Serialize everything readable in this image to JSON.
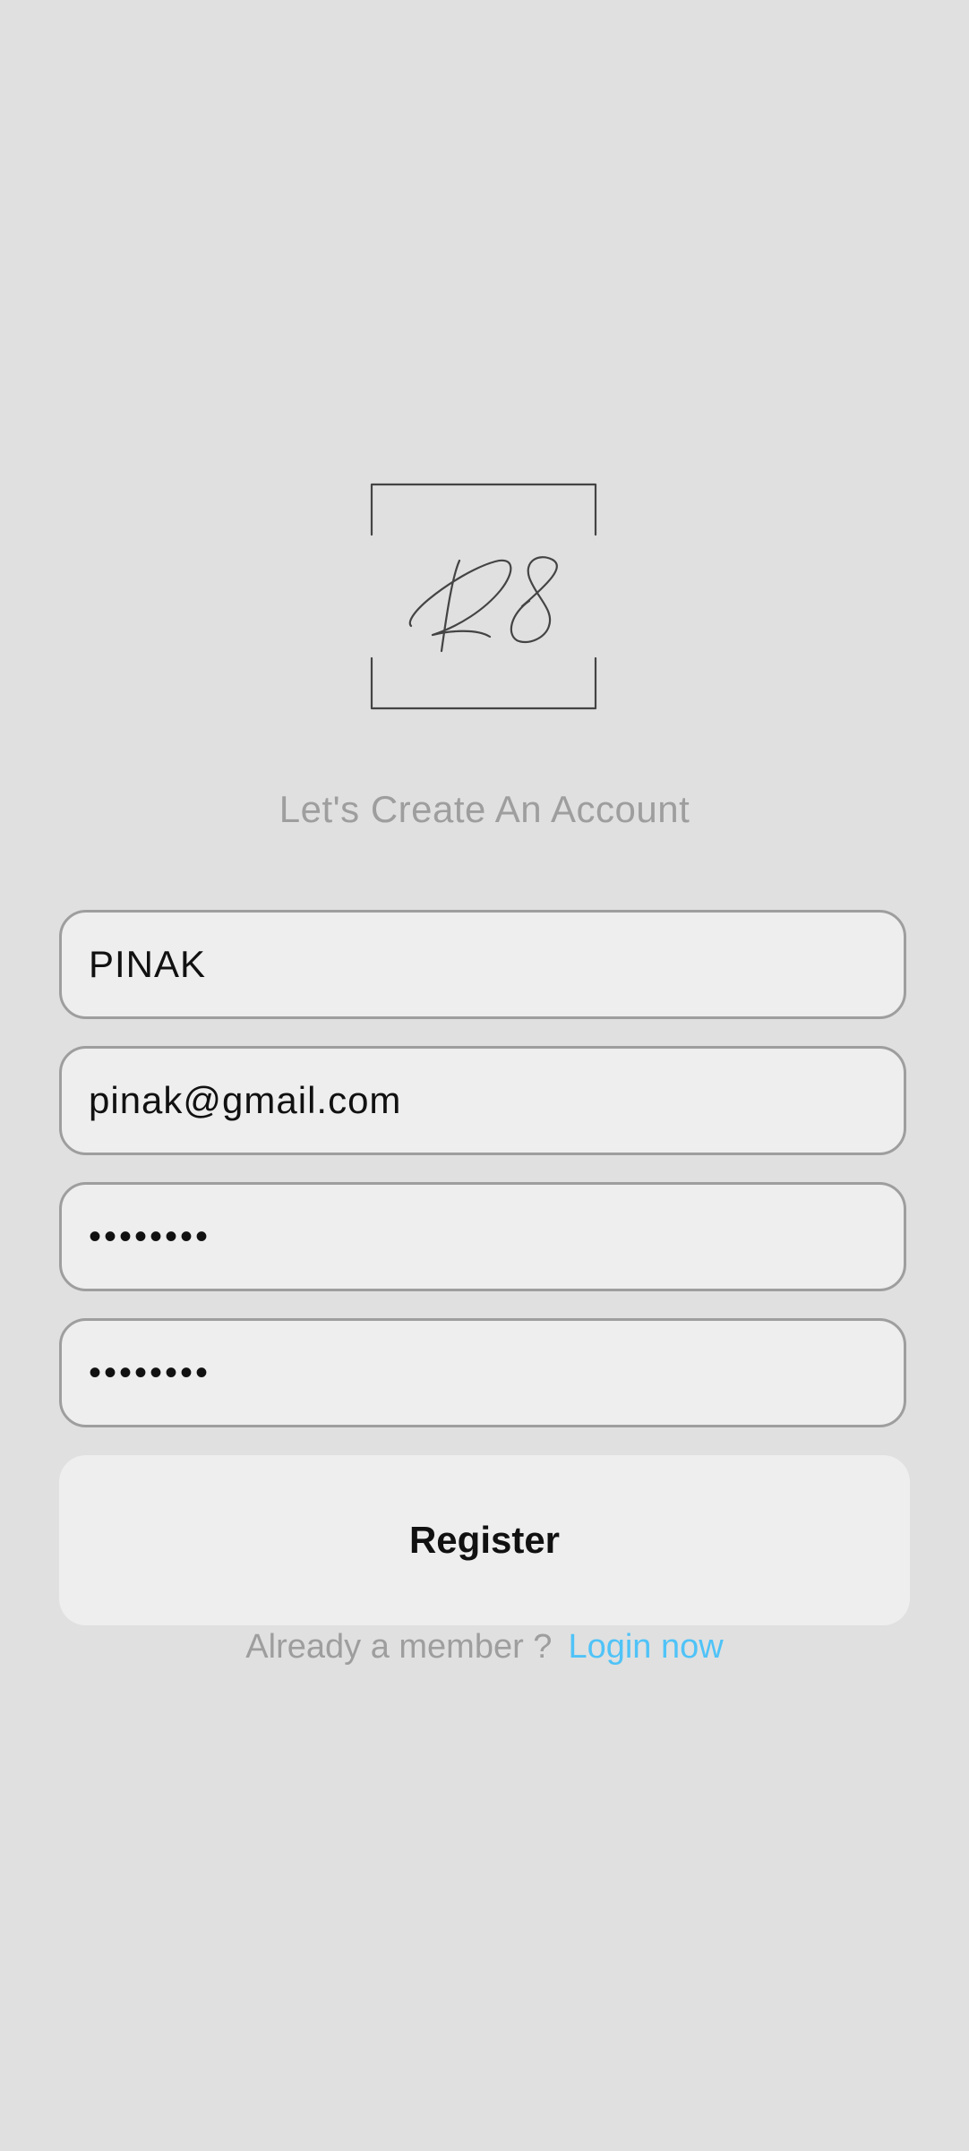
{
  "logo": {
    "name": "r8-logo",
    "stroke_color": "#444444"
  },
  "subtitle": "Let's Create An Account",
  "form": {
    "username": {
      "value": "PINAK"
    },
    "email": {
      "value": "pinak@gmail.com"
    },
    "password": {
      "value": "••••••••"
    },
    "confirm_password": {
      "value": "••••••••"
    }
  },
  "register_label": "Register",
  "footer": {
    "prompt": "Already a member ?",
    "link": "Login now"
  },
  "colors": {
    "background": "#e0e0e0",
    "field_bg": "#eeeeee",
    "field_border": "#9e9e9e",
    "muted_text": "#9e9e9e",
    "link": "#4fc3f7"
  }
}
